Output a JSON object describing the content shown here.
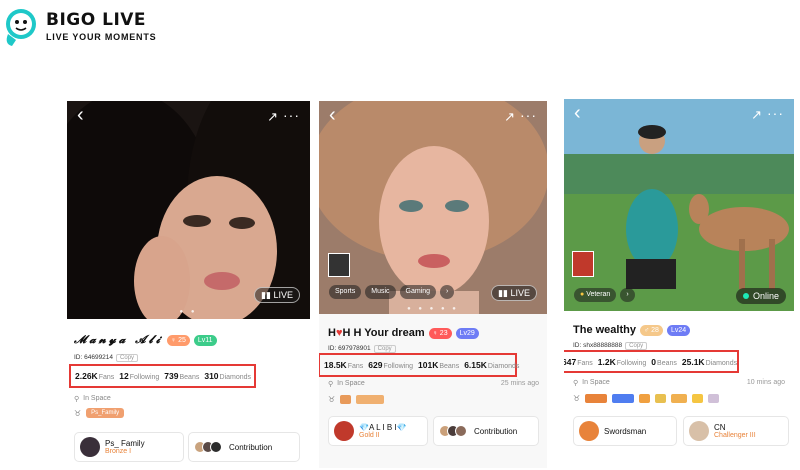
{
  "logo": {
    "brand": "BIGO LIVE",
    "tagline": "LIVE YOUR MOMENTS",
    "icon": "bigo-mascot-icon"
  },
  "cards": [
    {
      "name": "𝓜𝓪𝓷𝔂𝓪 𝓐𝓵𝓲",
      "level_gender": "♀ 25",
      "level": "Lv11",
      "id": "ID: 64699214",
      "copy": "Copy",
      "badge": "LIVE",
      "stats": {
        "fans": "2.26K",
        "fans_label": "Fans",
        "following": "12",
        "following_label": "Following",
        "beans": "739",
        "beans_label": "Beans",
        "diamonds": "310",
        "diamonds_label": "Diamonds"
      },
      "location": "In Space",
      "medal_label": "Ps_Family",
      "tile1": {
        "title": "Ps_ Family",
        "subtitle": "Bronze I"
      },
      "tile2": {
        "title": "Contribution"
      }
    },
    {
      "name": "H H Your dream",
      "level_gender": "♀ 23",
      "level": "Lv29",
      "id": "ID: 697978901",
      "copy": "Copy",
      "badge": "LIVE",
      "tags": [
        "Sports",
        "Music",
        "Gaming"
      ],
      "stats": {
        "fans": "18.5K",
        "fans_label": "Fans",
        "following": "629",
        "following_label": "Following",
        "beans": "101K",
        "beans_label": "Beans",
        "diamonds": "6.15K",
        "diamonds_label": "Diamonds"
      },
      "location": "In Space",
      "time": "25 mins ago",
      "tile1": {
        "title": "A L I B I",
        "subtitle": "Gold II"
      },
      "tile2": {
        "title": "Contribution"
      }
    },
    {
      "name": "The wealthy",
      "level_gender": "♂ 28",
      "level": "Lv24",
      "id": "ID: shx88888888",
      "copy": "Copy",
      "badge": "Online",
      "tags": [
        "Veteran"
      ],
      "stats": {
        "fans": "647",
        "fans_label": "Fans",
        "following": "1.2K",
        "following_label": "Following",
        "beans": "0",
        "beans_label": "Beans",
        "diamonds": "25.1K",
        "diamonds_label": "Diamonds"
      },
      "location": "In Space",
      "time": "10 mins ago",
      "tile1": {
        "title": "Swordsman"
      },
      "tile2": {
        "title": "CN",
        "subtitle": "Challenger III"
      }
    }
  ],
  "colors": {
    "highlight": "#e53935",
    "level_green": "#3ccc8a",
    "level_blue": "#6e7cf5",
    "rank_orange": "#e8833a"
  }
}
